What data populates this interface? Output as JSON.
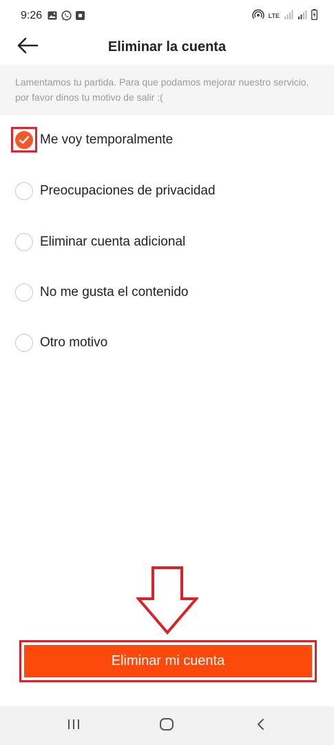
{
  "status_bar": {
    "time": "9:26",
    "left_icons": [
      "image-icon",
      "whatsapp-icon",
      "notification-square-icon"
    ],
    "right_icons": [
      "hotspot-icon",
      "lte-icon",
      "signal-icon",
      "signal-icon",
      "battery-icon"
    ],
    "lte_label": "LTE"
  },
  "header": {
    "back_icon": "arrow-left-icon",
    "title": "Eliminar la cuenta"
  },
  "info_text": "Lamentamos tu partida. Para que podamos mejorar nuestro servicio, por favor dinos tu motivo de salir :(",
  "reasons": [
    {
      "label": "Me voy temporalmente",
      "selected": true
    },
    {
      "label": "Preocupaciones de privacidad",
      "selected": false
    },
    {
      "label": "Eliminar cuenta adicional",
      "selected": false
    },
    {
      "label": "No me gusta el contenido",
      "selected": false
    },
    {
      "label": "Otro motivo",
      "selected": false
    }
  ],
  "delete_button": {
    "label": "Eliminar mi cuenta"
  },
  "annotations": {
    "arrow": "down-arrow-annotation",
    "highlight_color": "#e0242c"
  },
  "colors": {
    "accent": "#fd4a0c",
    "check": "#f05a28",
    "banner_bg": "#f5f5f5",
    "banner_text": "#9a9a9a"
  },
  "nav_bar": {
    "buttons": [
      "recent-apps-icon",
      "home-icon",
      "back-icon"
    ]
  }
}
